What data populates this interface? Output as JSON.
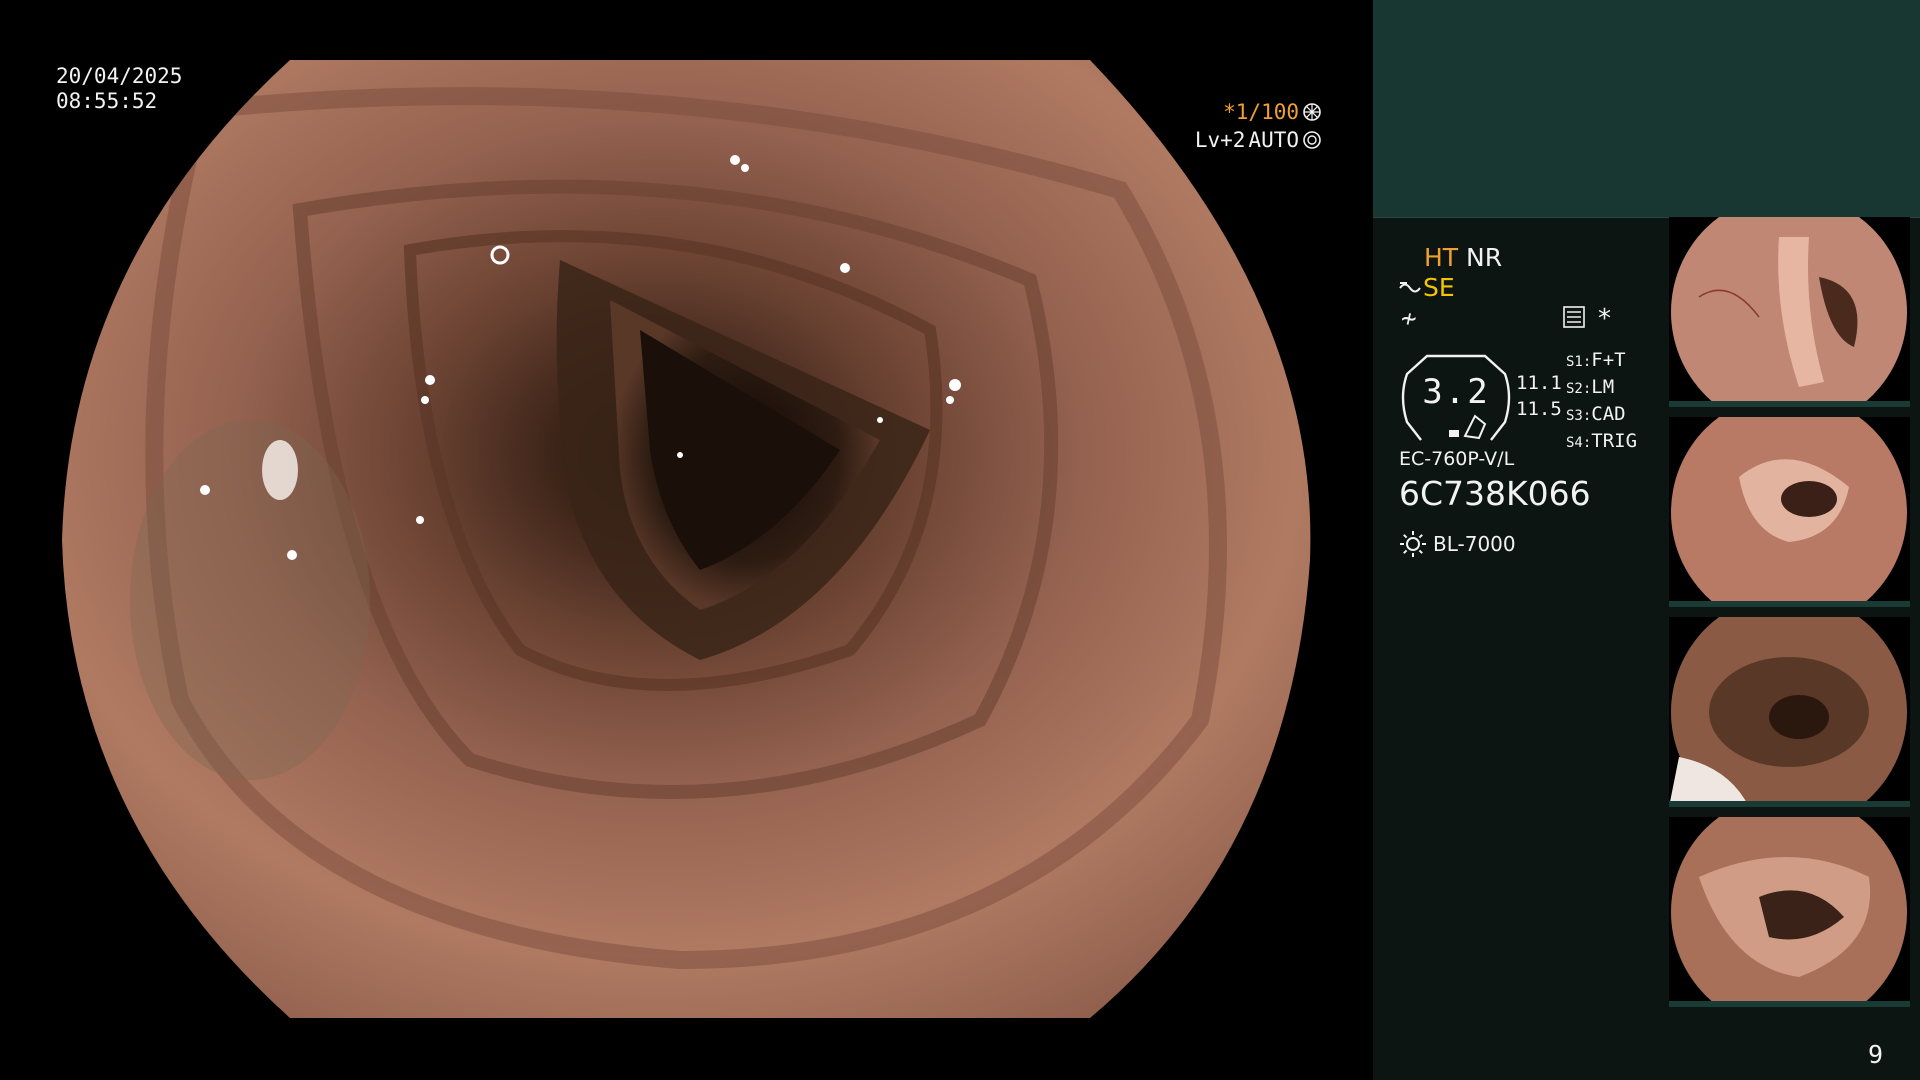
{
  "overlay": {
    "date": "20/04/2025",
    "time": "08:55:52",
    "shutter": "*1/100",
    "level": "Lv+2",
    "mode": "AUTO"
  },
  "panel": {
    "ht": "HT",
    "nr": "NR",
    "se": "SE",
    "f_symbol": "≁",
    "star": "*",
    "gauge_value": "3.2",
    "num_top": "11.1",
    "num_bottom": "11.5",
    "switches": [
      {
        "tag": "S1:",
        "value": "F+T"
      },
      {
        "tag": "S2:",
        "value": "LM"
      },
      {
        "tag": "S3:",
        "value": "CAD"
      },
      {
        "tag": "S4:",
        "value": "TRIG"
      }
    ],
    "scope_model": "EC-760P-V/L",
    "serial": "6C738K066",
    "light_source": "BL-7000",
    "page_number": "9"
  },
  "icons": {
    "shutter": "aperture-icon",
    "auto": "auto-iris-icon",
    "se": "structure-enhancement-icon",
    "menu": "menu-list-icon",
    "light": "light-source-icon"
  },
  "colors": {
    "panel_bg": "#0c1512",
    "panel_top": "#183632",
    "highlight_orange": "#f0a030",
    "highlight_yellow": "#f5c400",
    "tissue": "#b07a62"
  }
}
